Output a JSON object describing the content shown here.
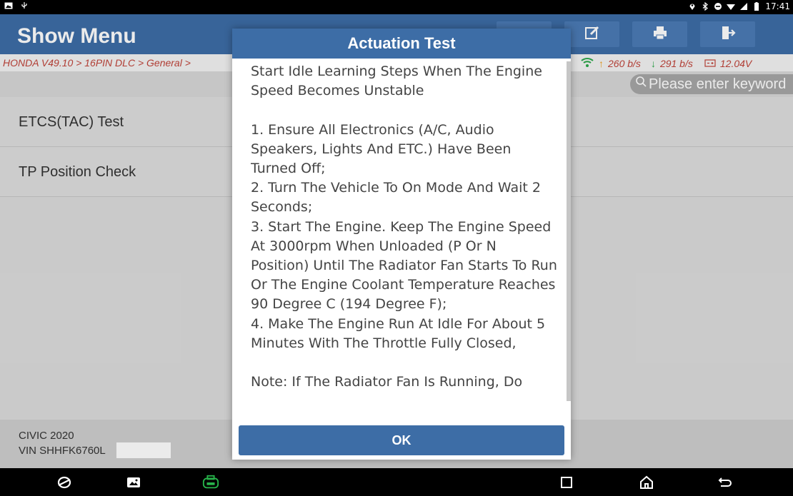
{
  "status_bar": {
    "time": "17:41",
    "left_icons": [
      "photo-icon",
      "usb-icon"
    ],
    "right_icons": [
      "location-icon",
      "bluetooth-icon",
      "dnd-icon",
      "wifi-icon",
      "signal-icon",
      "battery-icon"
    ]
  },
  "header": {
    "title": "Show Menu",
    "tools": [
      "edit-icon",
      "print-icon",
      "exit-icon"
    ]
  },
  "breadcrumb": {
    "text": "HONDA V49.10 > 16PIN DLC > General > ",
    "upload": "260 b/s",
    "download": "291 b/s",
    "voltage": "12.04V"
  },
  "search": {
    "placeholder": "Please enter keyword"
  },
  "menu": {
    "items": [
      {
        "label": "ETCS(TAC)  Test"
      },
      {
        "label": "TP Position Check"
      }
    ]
  },
  "footer": {
    "model": "CIVIC 2020",
    "vin": "VIN SHHFK6760L"
  },
  "dialog": {
    "title": "Actuation Test",
    "body": "Start Idle Learning Steps When The Engine Speed Becomes Unstable\n\n1. Ensure All Electronics (A/C, Audio Speakers, Lights And ETC.) Have Been Turned Off;\n2. Turn The Vehicle To On Mode And Wait 2 Seconds;\n3. Start The Engine. Keep The Engine Speed At 3000rpm When Unloaded (P Or N Position) Until The Radiator Fan Starts To Run Or The Engine Coolant Temperature Reaches 90 Degree C (194 Degree F);\n4. Make The Engine Run At Idle For About 5 Minutes With The Throttle Fully Closed,\n\nNote: If The Radiator Fan Is Running, Do",
    "ok_label": "OK"
  },
  "navbar": {
    "items": [
      "browser-icon",
      "gallery-icon",
      "vci-icon",
      "recents-icon",
      "home-icon",
      "back-icon"
    ]
  },
  "colors": {
    "primary": "#3d6da6",
    "breadcrumb_red": "#c0443a",
    "vci_green": "#27b34a",
    "upload_orange": "#f0a020",
    "download_green": "#2ca84a"
  }
}
